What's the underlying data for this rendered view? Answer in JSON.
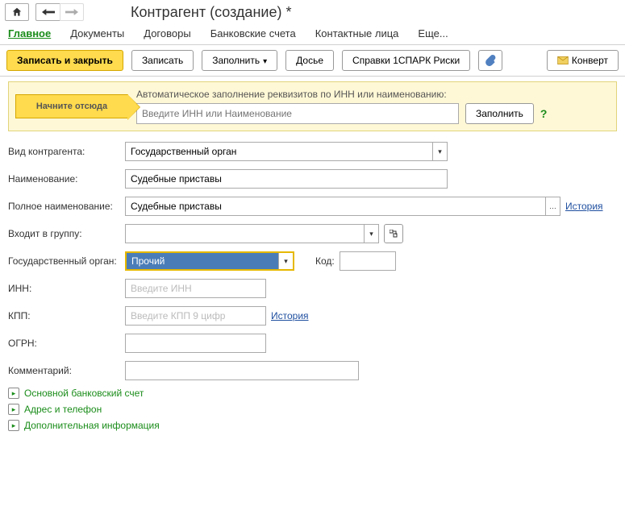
{
  "header": {
    "title": "Контрагент (создание) *"
  },
  "tabs": {
    "main": "Главное",
    "documents": "Документы",
    "contracts": "Договоры",
    "bank_accounts": "Банковские счета",
    "contacts": "Контактные лица",
    "more": "Еще..."
  },
  "toolbar": {
    "save_close": "Записать и закрыть",
    "save": "Записать",
    "fill": "Заполнить",
    "dossier": "Досье",
    "spark": "Справки 1СПАРК Риски",
    "convert": "Конверт"
  },
  "hint": {
    "start_here": "Начните отсюда",
    "text": "Автоматическое заполнение реквизитов по ИНН или наименованию:",
    "placeholder": "Введите ИНН или Наименование",
    "fill_button": "Заполнить"
  },
  "form": {
    "kind_label": "Вид контрагента:",
    "kind_value": "Государственный орган",
    "name_label": "Наименование:",
    "name_value": "Судебные приставы",
    "fullname_label": "Полное наименование:",
    "fullname_value": "Судебные приставы",
    "history_link": "История",
    "group_label": "Входит в группу:",
    "group_value": "",
    "gov_label": "Государственный орган:",
    "gov_value": "Прочий",
    "code_label": "Код:",
    "code_value": "",
    "inn_label": "ИНН:",
    "inn_placeholder": "Введите ИНН",
    "kpp_label": "КПП:",
    "kpp_placeholder": "Введите КПП 9 цифр",
    "kpp_history": "История",
    "ogrn_label": "ОГРН:",
    "ogrn_value": "",
    "comment_label": "Комментарий:",
    "comment_value": ""
  },
  "sections": {
    "bank": "Основной банковский счет",
    "address": "Адрес и телефон",
    "extra": "Дополнительная информация"
  }
}
